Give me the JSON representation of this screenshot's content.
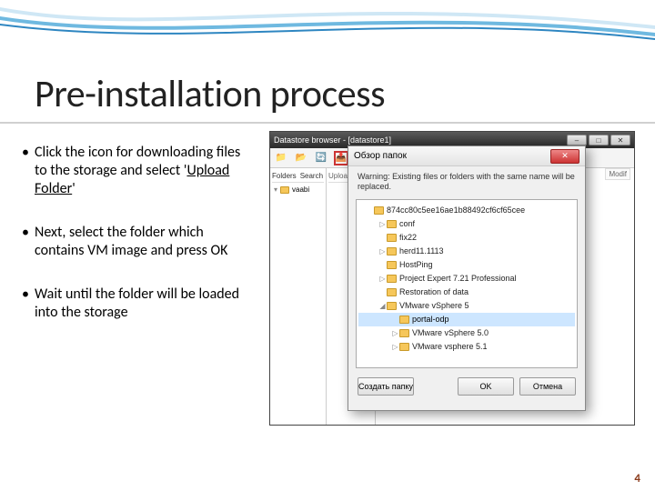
{
  "slide": {
    "title": "Pre-installation process",
    "page_number": "4"
  },
  "bullets": {
    "b1_pre": "Click the icon for downloading files to the storage and select '",
    "b1_link": "Upload Folder",
    "b1_post": "'",
    "b2": "Next, select the folder which contains VM image and press OK",
    "b3": "Wait until the folder will be loaded into the storage"
  },
  "datastore": {
    "window_title": "Datastore browser - [datastore1]",
    "tabs": {
      "folders": "Folders",
      "search": "Search"
    },
    "mid_header": "Upload",
    "item_vaabi": "vaabi",
    "right_col": "Modif"
  },
  "dialog": {
    "title": "Обзор папок",
    "warning": "Warning: Existing files or folders with the same name will be replaced.",
    "btn_new": "Создать папку",
    "btn_ok": "OK",
    "btn_cancel": "Отмена"
  },
  "tree": {
    "n0": "874cc80c5ee16ae1b88492cf6cf65cee",
    "n1": "conf",
    "n2": "fix22",
    "n3": "herd11.1113",
    "n4": "HostPing",
    "n5": "Project Expert 7.21 Professional",
    "n6": "Restoration of data",
    "n7": "VMware vSphere 5",
    "n7a": "portal-odp",
    "n7b": "VMware vSphere 5.0",
    "n7c": "VMware vsphere 5.1"
  }
}
